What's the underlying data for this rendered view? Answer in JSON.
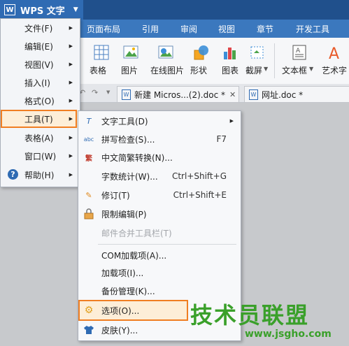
{
  "app": {
    "title": "WPS 文字",
    "logo": "W"
  },
  "ribbon_tabs": [
    "页面布局",
    "引用",
    "审阅",
    "视图",
    "章节",
    "开发工具"
  ],
  "toolbar": [
    {
      "label": "表格",
      "icon": "table-icon"
    },
    {
      "label": "图片",
      "icon": "picture-icon"
    },
    {
      "label": "在线图片",
      "icon": "online-picture-icon"
    },
    {
      "label": "形状",
      "icon": "shape-icon"
    },
    {
      "label": "图表",
      "icon": "chart-icon"
    },
    {
      "label": "截屏",
      "icon": "screenshot-icon"
    },
    {
      "label": "文本框",
      "icon": "textbox-icon"
    },
    {
      "label": "艺术字",
      "icon": "wordart-icon"
    }
  ],
  "doc_tabs": [
    {
      "label": "新建 Micros...(2).doc *",
      "close": "✕"
    },
    {
      "label": "网址.doc *"
    }
  ],
  "main_menu": [
    {
      "label": "文件(F)"
    },
    {
      "label": "编辑(E)"
    },
    {
      "label": "视图(V)"
    },
    {
      "label": "插入(I)"
    },
    {
      "label": "格式(O)"
    },
    {
      "label": "工具(T)"
    },
    {
      "label": "表格(A)"
    },
    {
      "label": "窗口(W)"
    },
    {
      "label": "帮助(H)"
    }
  ],
  "tools_menu": [
    {
      "label": "文字工具(D)",
      "icon": "text-tool-icon"
    },
    {
      "label": "拼写检查(S)...",
      "shortcut": "F7",
      "icon": "spellcheck-icon"
    },
    {
      "label": "中文简繁转换(N)...",
      "icon": "chinese-convert-icon"
    },
    {
      "label": "字数统计(W)...",
      "shortcut": "Ctrl+Shift+G"
    },
    {
      "label": "修订(T)",
      "shortcut": "Ctrl+Shift+E",
      "icon": "track-changes-icon"
    },
    {
      "label": "限制编辑(P)",
      "icon": "lock-icon"
    },
    {
      "label": "邮件合并工具栏(T)",
      "disabled": true
    },
    {
      "label": "COM加载项(A)..."
    },
    {
      "label": "加载项(I)..."
    },
    {
      "label": "备份管理(K)..."
    },
    {
      "label": "选项(O)...",
      "icon": "gear-icon"
    },
    {
      "label": "皮肤(Y)...",
      "icon": "shirt-icon"
    }
  ],
  "watermark": {
    "title": "技术员联盟",
    "url": "www.jsgho.com"
  },
  "colors": {
    "highlight": "#f07e22",
    "watermark": "#3aa02a",
    "brand": "#2f6bb3"
  }
}
